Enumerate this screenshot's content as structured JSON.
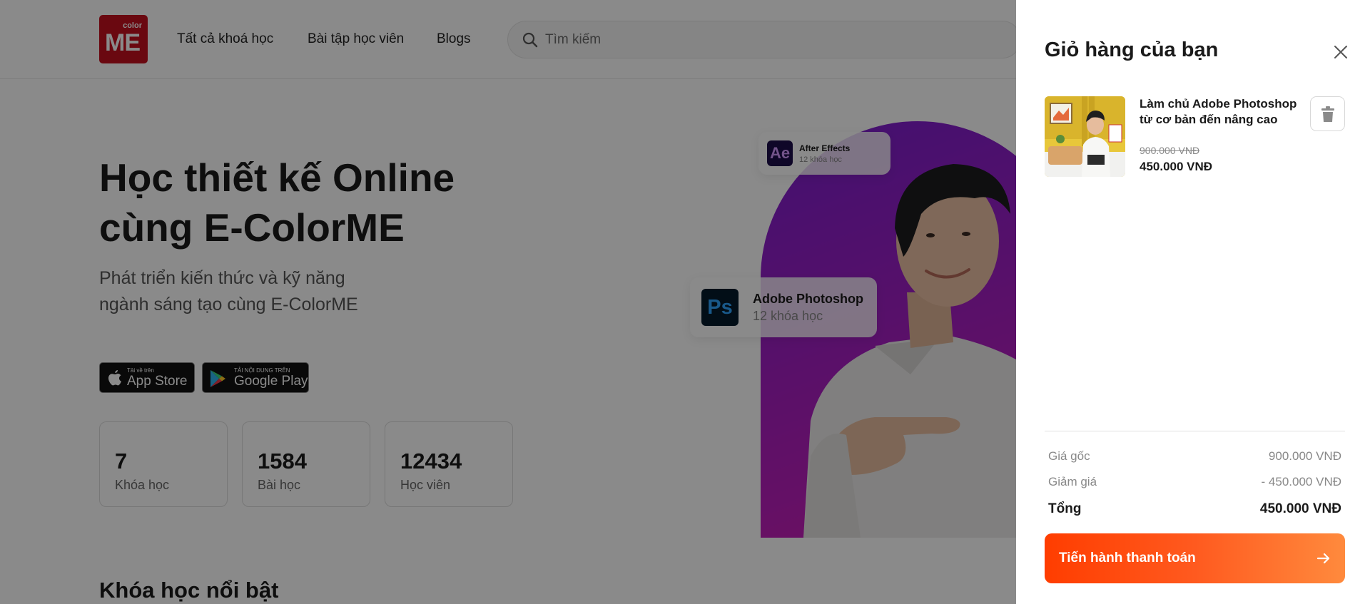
{
  "header": {
    "logo": {
      "small": "color",
      "big": "ME"
    },
    "nav": [
      "Tất cả khoá học",
      "Bài tập học viên",
      "Blogs"
    ],
    "search": {
      "placeholder": "Tìm kiếm",
      "value": ""
    }
  },
  "hero": {
    "title_line1": "Học thiết kế Online",
    "title_line2": "cùng E-ColorME",
    "subtitle_line1": "Phát triển kiến thức và kỹ năng",
    "subtitle_line2": "ngành sáng tạo cùng E-ColorME",
    "app_store": {
      "small": "Tải về trên",
      "large": "App Store"
    },
    "google_play": {
      "small": "TẢI NỘI DUNG TRÊN",
      "large": "Google Play"
    },
    "stats": [
      {
        "value": "7",
        "label": "Khóa học"
      },
      {
        "value": "1584",
        "label": "Bài học"
      },
      {
        "value": "12434",
        "label": "Học viên"
      }
    ],
    "chips": {
      "ae": {
        "icon_text": "Ae",
        "name": "After Effects",
        "count": "12 khóa học"
      },
      "ps": {
        "icon_text": "Ps",
        "name": "Adobe Photoshop",
        "count": "12 khóa học"
      }
    }
  },
  "featured_section": {
    "title": "Khóa học nổi bật"
  },
  "cart": {
    "title": "Giỏ hàng của bạn",
    "item": {
      "title": "Làm chủ Adobe Photoshop từ cơ bản đến nâng cao",
      "original_price": "900.000 VNĐ",
      "price": "450.000 VNĐ"
    },
    "summary": {
      "original_label": "Giá gốc",
      "original_value": "900.000 VNĐ",
      "discount_label": "Giảm giá",
      "discount_value": "- 450.000 VNĐ",
      "total_label": "Tổng",
      "total_value": "450.000 VNĐ"
    },
    "checkout_label": "Tiến hành thanh toán"
  },
  "icons": [
    "search-icon",
    "apple-icon",
    "google-play-icon",
    "close-icon",
    "trash-icon",
    "arrow-right-icon"
  ],
  "colors": {
    "brand_red": "#c50f1e",
    "checkout_gradient_start": "#ff3d00",
    "checkout_gradient_end": "#ff8a3d",
    "arch_purple": "#7a1fd0",
    "arch_pink": "#d21fb4",
    "overlay": "rgba(0,0,0,0.46)"
  }
}
